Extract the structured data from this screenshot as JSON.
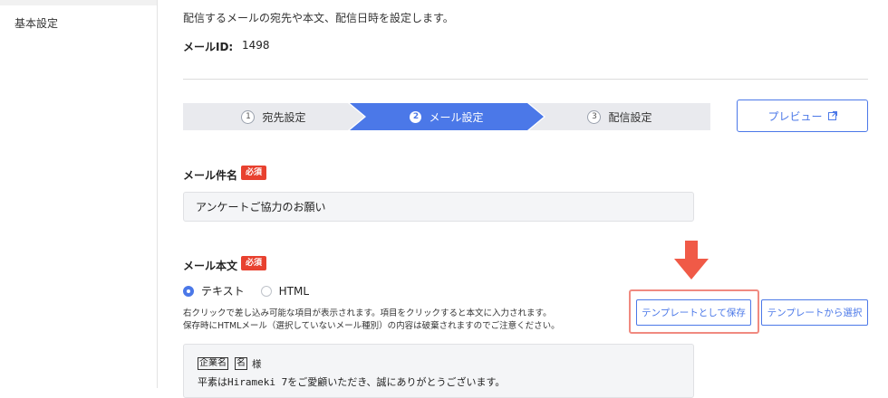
{
  "sidebar": {
    "items": [
      {
        "label": "基本設定"
      }
    ]
  },
  "header": {
    "description": "配信するメールの宛先や本文、配信日時を設定します。",
    "mail_id_label": "メールID:",
    "mail_id_value": "1498"
  },
  "stepper": {
    "steps": [
      {
        "number": "1",
        "label": "宛先設定",
        "active": false
      },
      {
        "number": "2",
        "label": "メール設定",
        "active": true
      },
      {
        "number": "3",
        "label": "配信設定",
        "active": false
      }
    ]
  },
  "preview_button": {
    "label": "プレビュー",
    "icon": "external-link-icon"
  },
  "subject": {
    "label": "メール件名",
    "required_badge": "必須",
    "value": "アンケートご協力のお願い"
  },
  "body": {
    "label": "メール本文",
    "required_badge": "必須",
    "format_options": [
      {
        "label": "テキスト",
        "selected": true
      },
      {
        "label": "HTML",
        "selected": false
      }
    ],
    "notes": [
      "右クリックで差し込み可能な項目が表示されます。項目をクリックすると本文に入力されます。",
      "保存時にHTMLメール（選択していないメール種別）の内容は破棄されますのでご注意ください。"
    ],
    "template_save_button": "テンプレートとして保存",
    "template_select_button": "テンプレートから選択",
    "editor": {
      "insert_tag_company": "企業名",
      "insert_tag_name": "名",
      "salutation_suffix": "様",
      "line2": "平素はHirameki 7をご愛顧いただき、誠にありがとうございます。"
    }
  },
  "colors": {
    "accent": "#4b78e8",
    "required": "#e8412f",
    "callout": "#f05a47"
  }
}
